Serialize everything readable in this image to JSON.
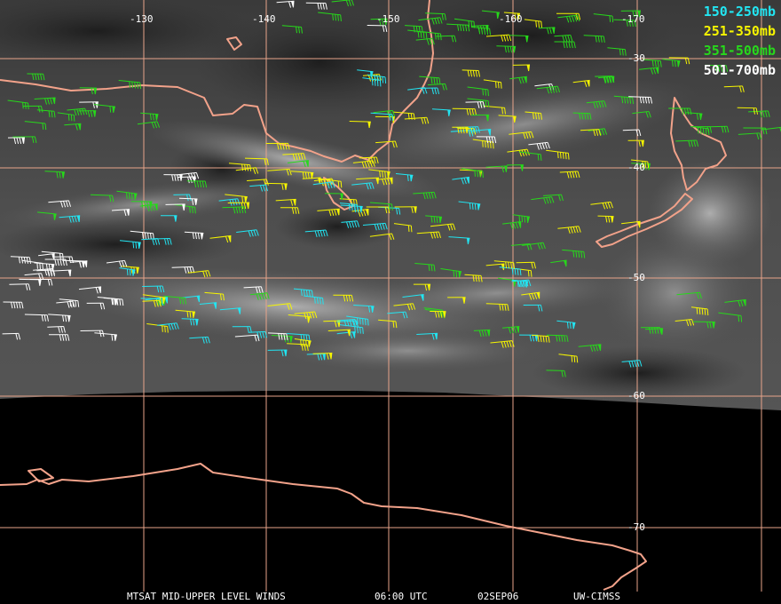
{
  "map": {
    "longitude_labels": [
      "-130",
      "-140",
      "-150",
      "-160",
      "-170"
    ],
    "latitude_labels": [
      "-30",
      "-40",
      "-50",
      "-60",
      "-70"
    ],
    "legend": [
      {
        "label": "150-250mb",
        "color": "#22e5f2"
      },
      {
        "label": "251-350mb",
        "color": "#f6f500"
      },
      {
        "label": "351-500mb",
        "color": "#27d81b"
      },
      {
        "label": "501-700mb",
        "color": "#ffffff"
      }
    ],
    "footer": {
      "product": "MTSAT MID-UPPER LEVEL WINDS",
      "time": "06:00 UTC",
      "date": "02SEP06",
      "source": "UW-CIMSS"
    },
    "colors": {
      "coastline": "#f2a28a",
      "gridline": "#e8a48a",
      "background": "#000000"
    }
  }
}
